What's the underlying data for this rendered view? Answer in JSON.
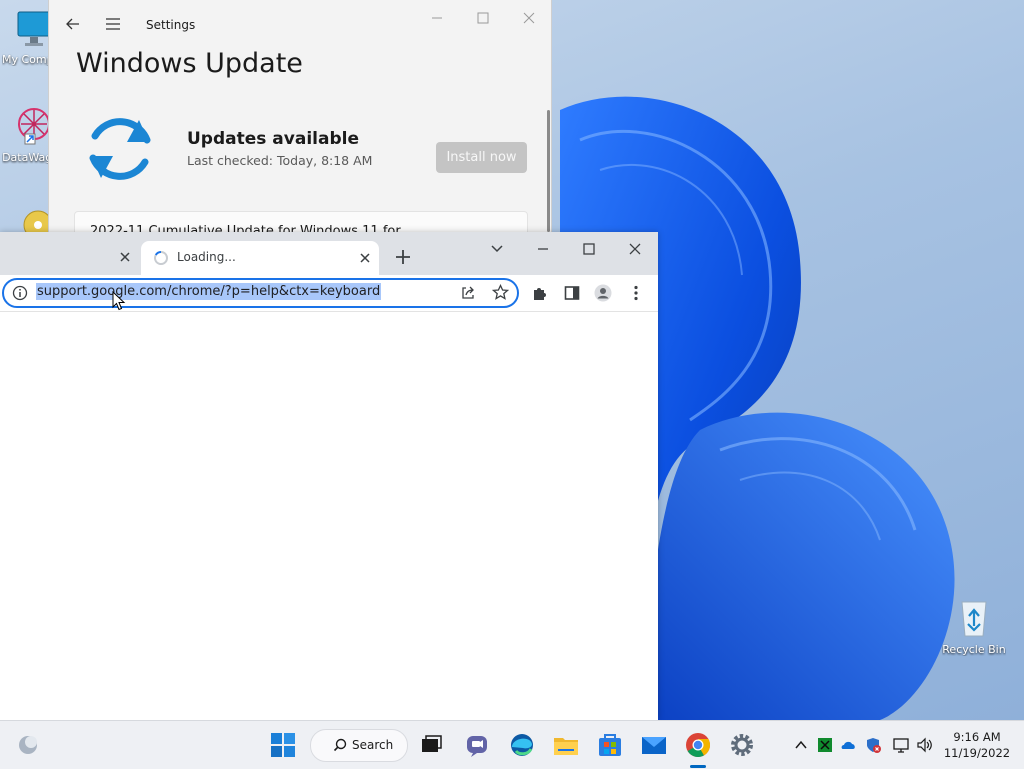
{
  "desktop": {
    "icons": [
      {
        "label": "My Computer",
        "icon": "monitor-icon"
      },
      {
        "label": "DataWagon",
        "icon": "app-shortcut-icon"
      },
      {
        "label": "Recycle Bin",
        "icon": "recycle-bin-icon"
      }
    ],
    "wallpaper": "windows-11-bloom"
  },
  "settings": {
    "app_title": "Settings",
    "page_title": "Windows Update",
    "status_title": "Updates available",
    "last_checked": "Last checked: Today, 8:18 AM",
    "install_label": "Install now",
    "update_item": "2022-11 Cumulative Update for Windows 11 for"
  },
  "chrome": {
    "active_tab_title": "Loading...",
    "url": "support.google.com/chrome/?p=help&ctx=keyboard",
    "accent": "#1a73e8"
  },
  "taskbar": {
    "search_label": "Search",
    "time": "9:16 AM",
    "date": "11/19/2022",
    "pinned": [
      "start-icon",
      "search-icon",
      "task-view-icon",
      "teams-chat-icon",
      "edge-icon",
      "file-explorer-icon",
      "store-icon",
      "mail-icon",
      "chrome-icon",
      "settings-gear-icon"
    ]
  }
}
